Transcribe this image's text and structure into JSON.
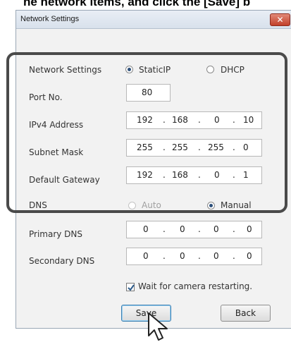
{
  "caption": "ne network items, and click the [Save] b",
  "window": {
    "title": "Network Settings",
    "close_glyph": "✕"
  },
  "network_settings": {
    "label": "Network Settings",
    "options": [
      {
        "label": "StaticIP",
        "selected": true
      },
      {
        "label": "DHCP",
        "selected": false
      }
    ]
  },
  "port": {
    "label": "Port No.",
    "value": "80"
  },
  "ipv4": {
    "label": "IPv4 Address",
    "octets": [
      "192",
      "168",
      "0",
      "10"
    ]
  },
  "subnet": {
    "label": "Subnet Mask",
    "octets": [
      "255",
      "255",
      "255",
      "0"
    ]
  },
  "gateway": {
    "label": "Default Gateway",
    "octets": [
      "192",
      "168",
      "0",
      "1"
    ]
  },
  "dns": {
    "label": "DNS",
    "options": [
      {
        "label": "Auto",
        "selected": false,
        "enabled": false
      },
      {
        "label": "Manual",
        "selected": true,
        "enabled": true
      }
    ]
  },
  "primary_dns": {
    "label": "Primary DNS",
    "octets": [
      "0",
      "0",
      "0",
      "0"
    ]
  },
  "secondary_dns": {
    "label": "Secondary DNS",
    "octets": [
      "0",
      "0",
      "0",
      "0"
    ]
  },
  "wait_restart": {
    "label": "Wait for camera restarting.",
    "checked": true
  },
  "buttons": {
    "save": "Save",
    "back": "Back"
  },
  "ip_separator": ".",
  "colors": {
    "highlight": "#4a4a4a",
    "radio_on": "#2c4f7a",
    "close": "#c2402a"
  },
  "icons": {
    "close": "close-icon",
    "cursor": "mouse-pointer-icon",
    "check": "checkmark-icon"
  }
}
